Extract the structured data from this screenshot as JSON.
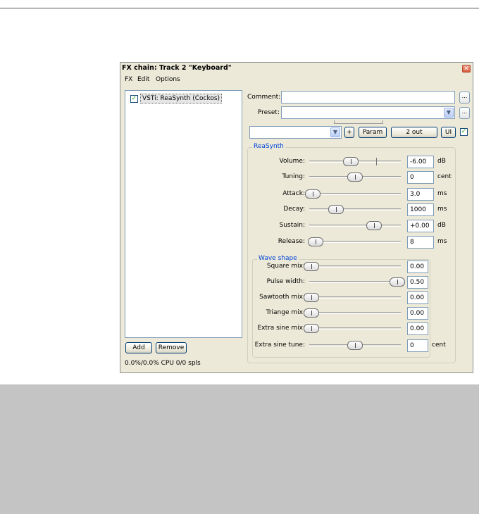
{
  "window": {
    "title": "FX chain: Track 2 \"Keyboard\"",
    "close_symbol": "✕"
  },
  "menu": [
    "FX",
    "Edit",
    "Options"
  ],
  "fx_list": {
    "items": [
      {
        "label": "VSTi: ReaSynth (Cockos)",
        "checked": true
      }
    ]
  },
  "buttons": {
    "add": "Add",
    "remove": "Remove"
  },
  "status": {
    "cpu": "0.0%/0.0% CPU 0/0 spls"
  },
  "comment": {
    "label": "Comment:",
    "value": "",
    "browse": "..."
  },
  "preset": {
    "label": "Preset:",
    "value": "",
    "browse": "..."
  },
  "toolbar": {
    "dropdown_value": "",
    "plus": "+",
    "param": "Param",
    "out": "2 out",
    "ui": "UI",
    "enabled": true
  },
  "reasynth": {
    "group_title": "ReaSynth",
    "params": [
      {
        "name": "volume",
        "label": "Volume:",
        "value": "-6.00",
        "unit": "dB",
        "level": 0.45
      },
      {
        "name": "tuning",
        "label": "Tuning:",
        "value": "0",
        "unit": "cent",
        "level": 0.5
      },
      {
        "name": "attack",
        "label": "Attack:",
        "value": "3.0",
        "unit": "ms",
        "level": 0.02
      },
      {
        "name": "decay",
        "label": "Decay:",
        "value": "1000",
        "unit": "ms",
        "level": 0.28
      },
      {
        "name": "sustain",
        "label": "Sustain:",
        "value": "+0.00",
        "unit": "dB",
        "level": 0.72
      },
      {
        "name": "release",
        "label": "Release:",
        "value": "8",
        "unit": "ms",
        "level": 0.05
      }
    ]
  },
  "wave_shape": {
    "group_title": "Wave shape",
    "params": [
      {
        "name": "square-mix",
        "label": "Square mix:",
        "value": "0.00",
        "unit": "",
        "level": 0.0
      },
      {
        "name": "pulse-width",
        "label": "Pulse width:",
        "value": "0.50",
        "unit": "",
        "level": 0.98
      },
      {
        "name": "sawtooth-mix",
        "label": "Sawtooth mix:",
        "value": "0.00",
        "unit": "",
        "level": 0.0
      },
      {
        "name": "triangle-mix",
        "label": "Triange mix:",
        "value": "0.00",
        "unit": "",
        "level": 0.0
      },
      {
        "name": "extra-sine-mix",
        "label": "Extra sine mix:",
        "value": "0.00",
        "unit": "",
        "level": 0.0
      },
      {
        "name": "extra-sine-tune",
        "label": "Extra sine tune:",
        "value": "0",
        "unit": "cent",
        "level": 0.5
      }
    ]
  }
}
